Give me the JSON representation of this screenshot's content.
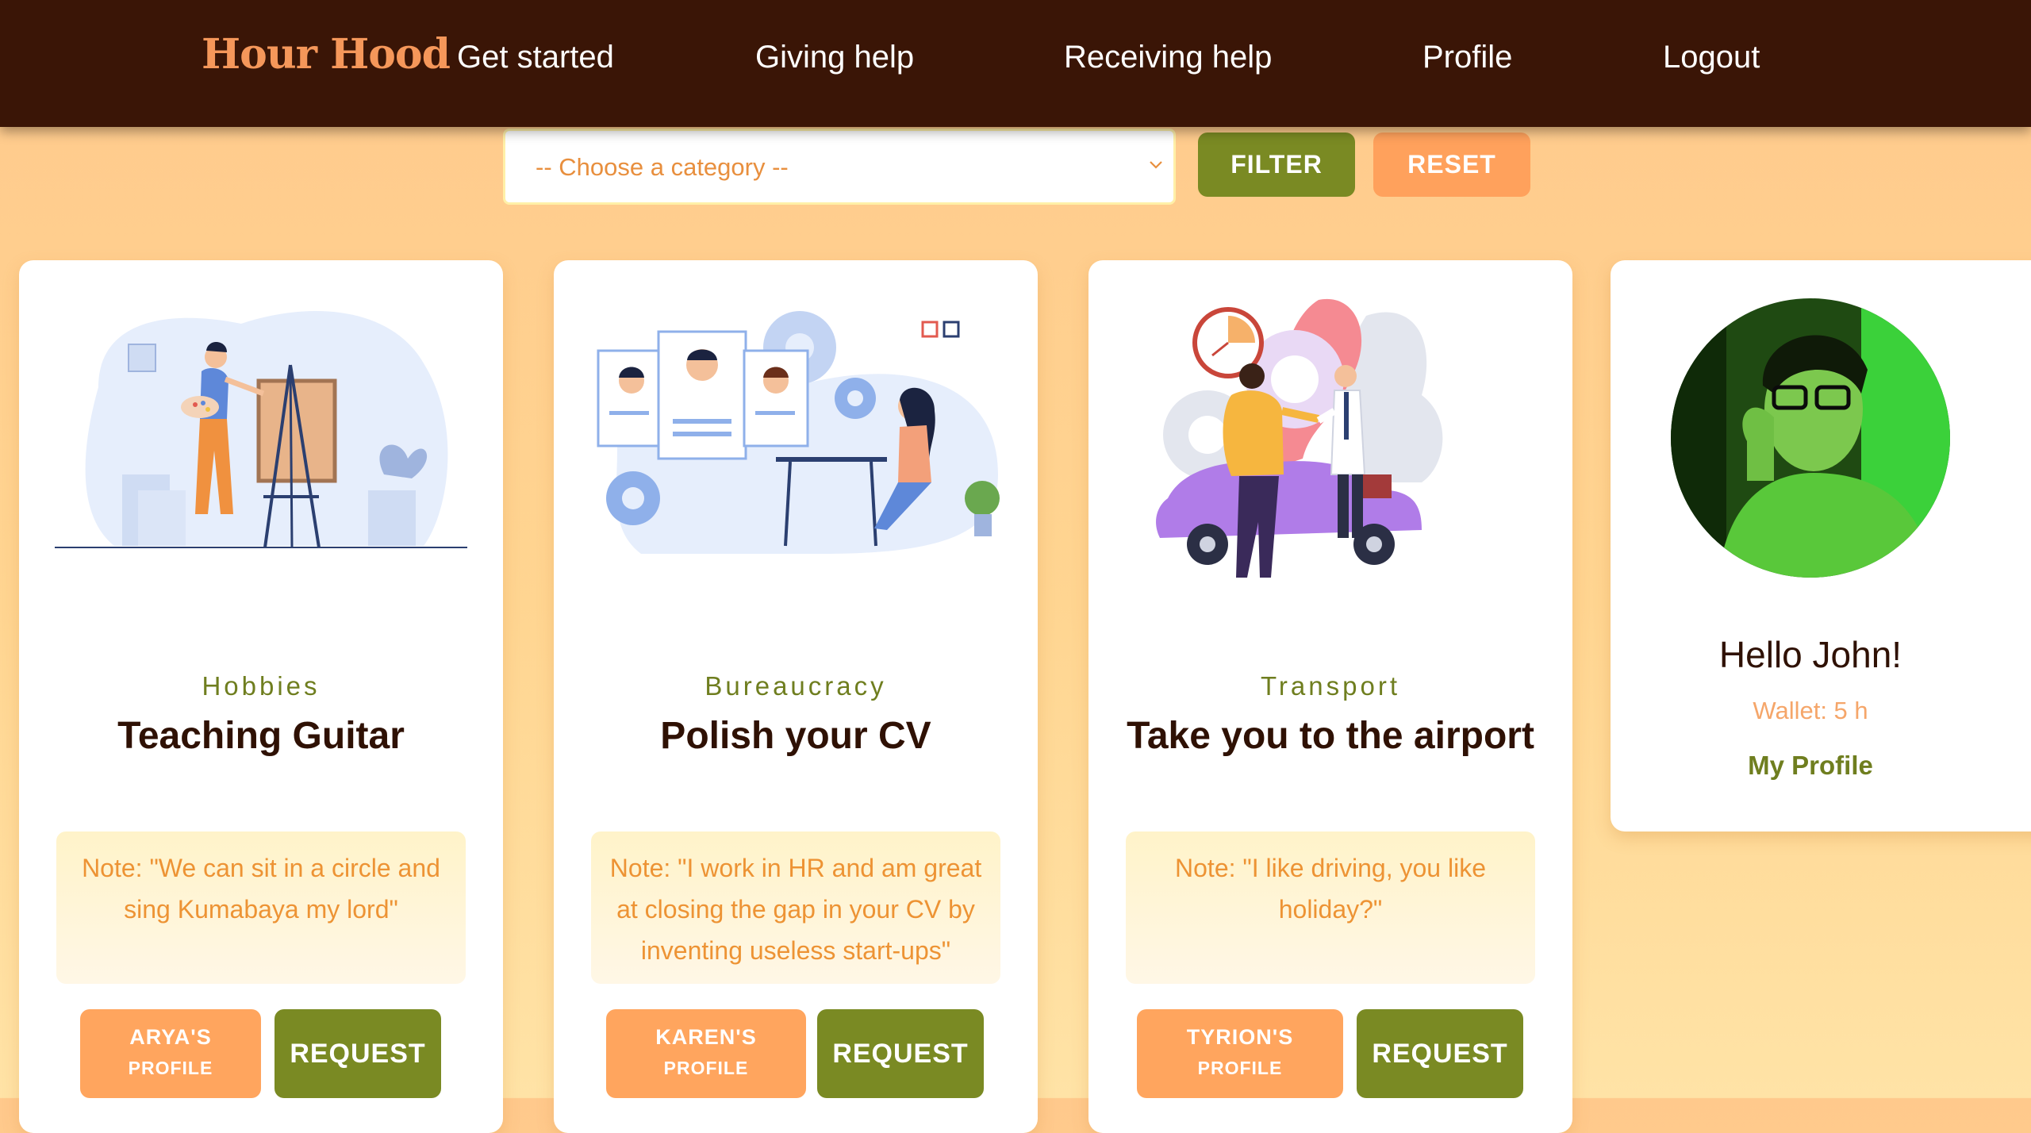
{
  "nav": {
    "brand": "Hour Hood",
    "links": [
      "Get started",
      "Giving help",
      "Receiving help",
      "Profile",
      "Logout"
    ]
  },
  "filter": {
    "category_placeholder": "-- Choose a category --",
    "filter_label": "FILTER",
    "reset_label": "RESET"
  },
  "cards": [
    {
      "category": "Hobbies",
      "title": "Teaching Guitar",
      "note": "Note: \"We can sit in a circle and sing Kumabaya my lord\"",
      "profile_line1": "ARYA'S",
      "profile_line2": "PROFILE",
      "request_label": "REQUEST"
    },
    {
      "category": "Bureaucracy",
      "title": "Polish your CV",
      "note": "Note: \"I work in HR and am great at closing the gap in your CV by inventing useless start-ups\"",
      "profile_line1": "KAREN'S",
      "profile_line2": "PROFILE",
      "request_label": "REQUEST"
    },
    {
      "category": "Transport",
      "title": "Take you to the airport",
      "note": "Note: \"I like driving, you like holiday?\"",
      "profile_line1": "TYRION'S",
      "profile_line2": "PROFILE",
      "request_label": "REQUEST"
    }
  ],
  "profile_card": {
    "greeting": "Hello John!",
    "wallet": "Wallet: 5 h",
    "link": "My Profile"
  },
  "colors": {
    "nav_bg": "#3a1506",
    "brand": "#f5975a",
    "olive": "#7a8a23",
    "orange": "#ffa15c",
    "page_bg": "#ffcf8f"
  }
}
